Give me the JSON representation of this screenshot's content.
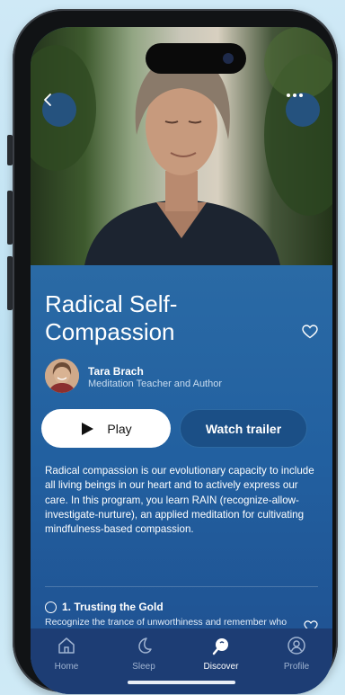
{
  "program": {
    "title": "Radical Self-Compassion",
    "author_name": "Tara Brach",
    "author_role": "Meditation Teacher and Author",
    "play_label": "Play",
    "trailer_label": "Watch trailer",
    "description": "Radical compassion is our evolutionary capacity to include all living beings in our heart and to actively express our care. In this program, you learn RAIN (recognize-allow-investigate-nurture), an applied meditation for cultivating mindfulness-based compassion."
  },
  "lessons": [
    {
      "title": "1. Trusting the Gold",
      "subtitle": "Recognize the trance of unworthiness and remember who you are"
    }
  ],
  "tabs": [
    {
      "label": "Home",
      "icon": "home-icon",
      "active": false
    },
    {
      "label": "Sleep",
      "icon": "moon-icon",
      "active": false
    },
    {
      "label": "Discover",
      "icon": "discover-icon",
      "active": true
    },
    {
      "label": "Profile",
      "icon": "profile-icon",
      "active": false
    }
  ],
  "colors": {
    "accent": "#2a6aa5",
    "tabbar": "#1d3d74",
    "button_dark": "#1b4f86"
  }
}
